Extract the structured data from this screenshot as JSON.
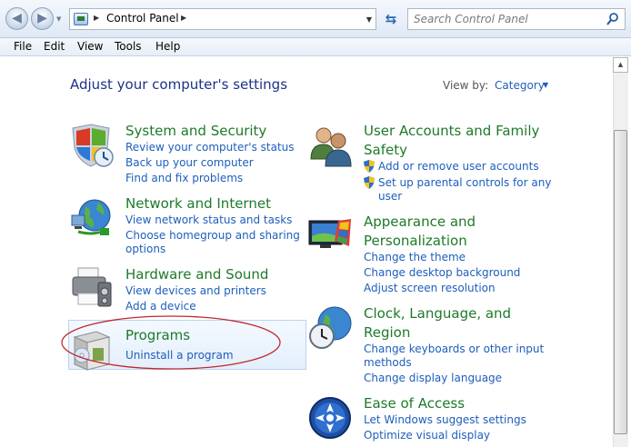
{
  "addressbar": {
    "breadcrumb": "Control Panel",
    "search_placeholder": "Search Control Panel"
  },
  "menu": [
    "File",
    "Edit",
    "View",
    "Tools",
    "Help"
  ],
  "main": {
    "heading": "Adjust your computer's settings",
    "view_by_label": "View by:",
    "view_by_value": "Category"
  },
  "categories_left": [
    {
      "title": "System and Security",
      "icon": "shield-icon",
      "links": [
        "Review your computer's status",
        "Back up your computer",
        "Find and fix problems"
      ]
    },
    {
      "title": "Network and Internet",
      "icon": "network-globe-icon",
      "links": [
        "View network status and tasks",
        "Choose homegroup and sharing",
        "options"
      ]
    },
    {
      "title": "Hardware and Sound",
      "icon": "printer-icon",
      "links": [
        "View devices and printers",
        "Add a device"
      ]
    },
    {
      "title": "Programs",
      "icon": "programs-box-icon",
      "links": [
        "Uninstall a program"
      ]
    }
  ],
  "categories_right": [
    {
      "title_lines": [
        "User Accounts and Family",
        "Safety"
      ],
      "icon": "users-icon",
      "links": [
        "Add or remove user accounts",
        "Set up parental controls for any",
        "user"
      ]
    },
    {
      "title_lines": [
        "Appearance and",
        "Personalization"
      ],
      "icon": "monitor-paint-icon",
      "links": [
        "Change the theme",
        "Change desktop background",
        "Adjust screen resolution"
      ]
    },
    {
      "title_lines": [
        "Clock, Language, and",
        "Region"
      ],
      "icon": "clock-globe-icon",
      "links": [
        "Change keyboards or other input",
        "methods",
        "Change display language"
      ]
    },
    {
      "title_lines": [
        "Ease of Access"
      ],
      "icon": "ease-of-access-icon",
      "links": [
        "Let Windows suggest settings",
        "Optimize visual display"
      ]
    }
  ],
  "colors": {
    "category_title": "#1e7a2a",
    "link": "#1e5ebc",
    "heading": "#1e3287",
    "annotation_ellipse": "#c0272d"
  }
}
